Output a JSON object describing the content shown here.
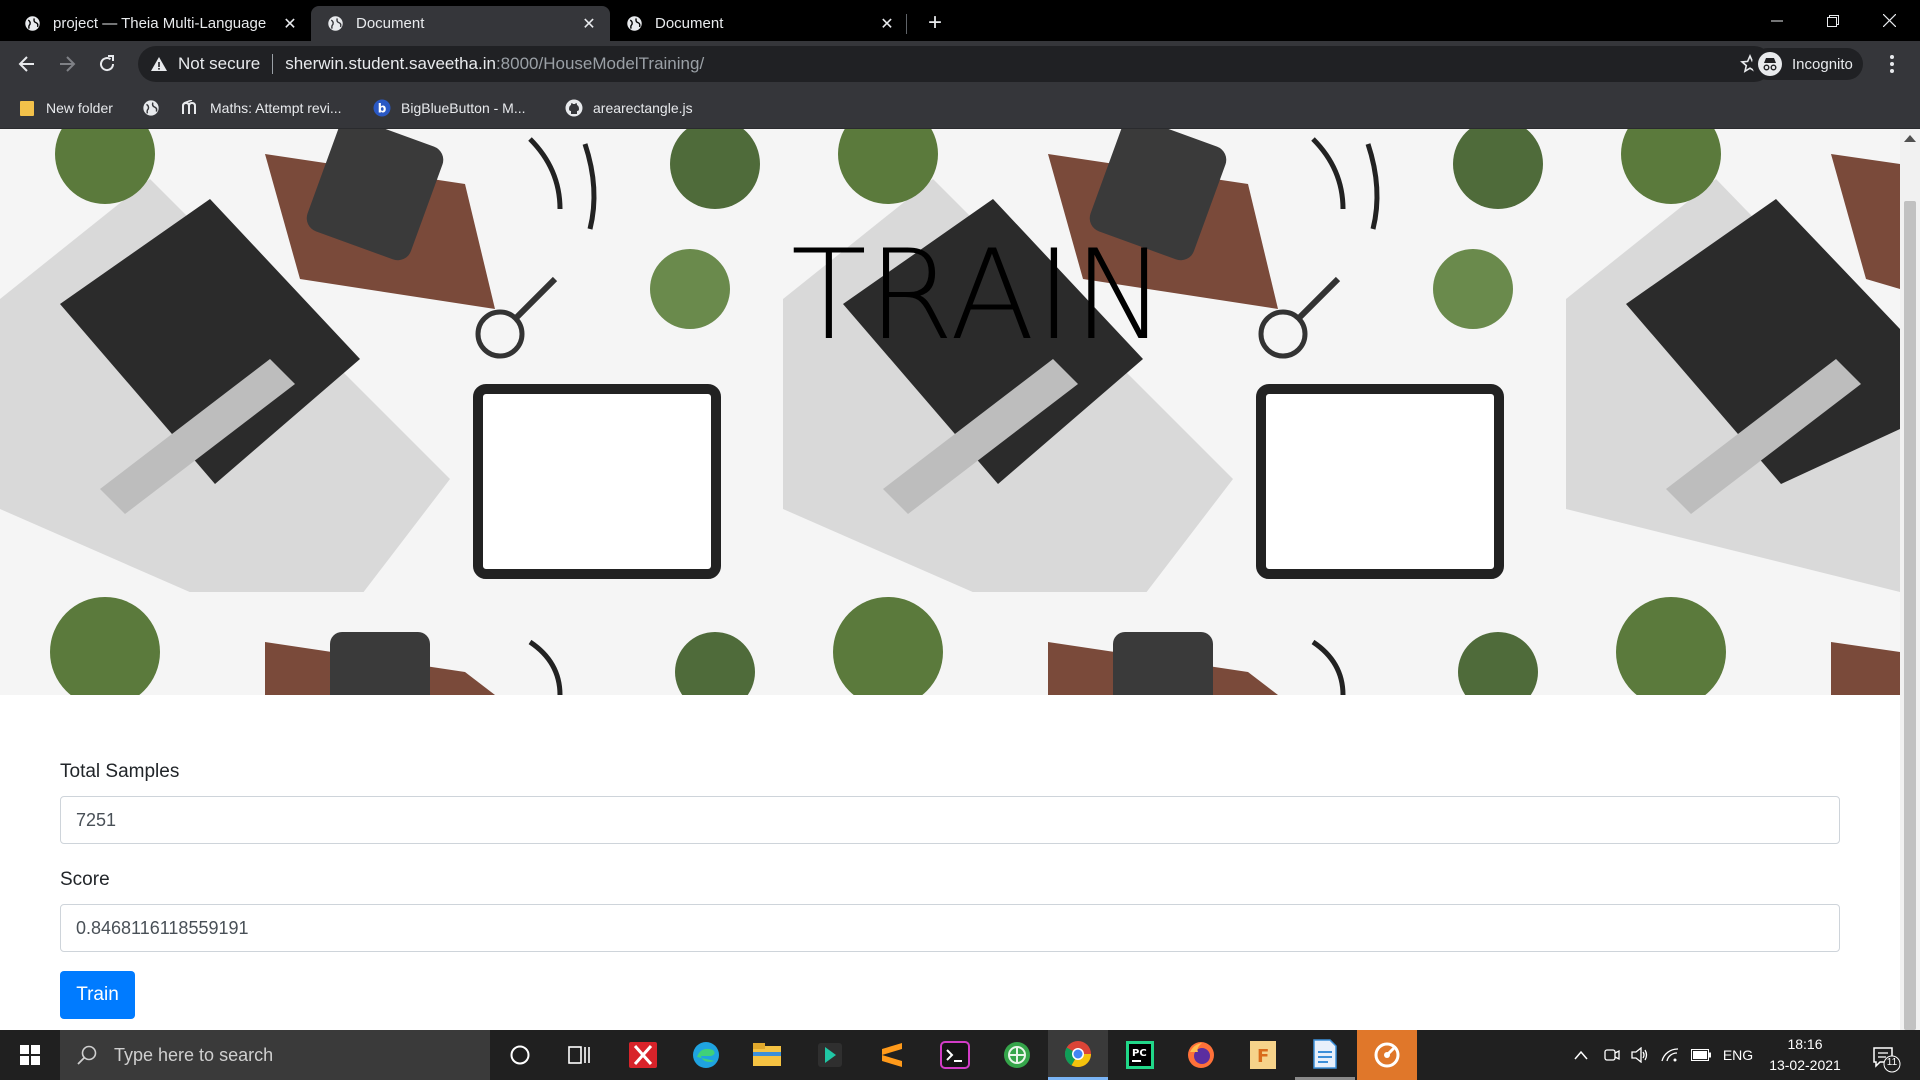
{
  "tabs": [
    {
      "title": "project — Theia Multi-Language",
      "active": false
    },
    {
      "title": "Document",
      "active": true
    },
    {
      "title": "Document",
      "active": false
    }
  ],
  "toolbar": {
    "security_label": "Not secure",
    "url_host": "sherwin.student.saveetha.in",
    "url_path": ":8000/HouseModelTraining/",
    "profile_label": "Incognito"
  },
  "bookmarks": [
    {
      "label": "New folder",
      "icon": "folder-icon"
    },
    {
      "label": "",
      "icon": "globe-icon"
    },
    {
      "label": "Maths: Attempt revi...",
      "icon": "moodle-icon"
    },
    {
      "label": "BigBlueButton - M...",
      "icon": "bigbluebutton-icon"
    },
    {
      "label": "arearectangle.js",
      "icon": "github-icon"
    }
  ],
  "hero": {
    "title": "TRAIN"
  },
  "form": {
    "total_samples_label": "Total Samples",
    "total_samples_value": "7251",
    "score_label": "Score",
    "score_value": "0.8468116118559191",
    "train_label": "Train"
  },
  "taskbar": {
    "search_placeholder": "Type here to search",
    "language": "ENG",
    "time": "18:16",
    "date": "13-02-2021",
    "notification_count": "11"
  },
  "colors": {
    "primary": "#007bff",
    "tab_active": "#35363a",
    "tab_strip": "#000000",
    "omnibox": "#202124"
  }
}
